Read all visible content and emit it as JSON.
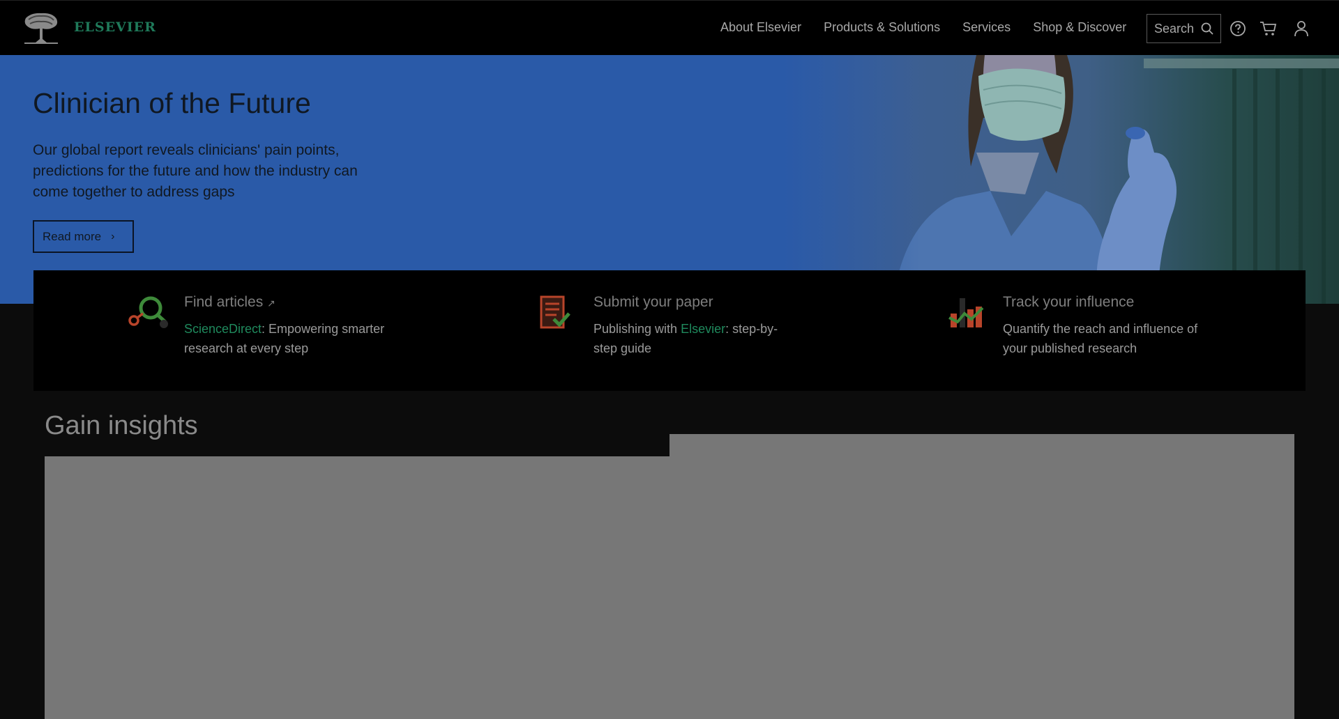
{
  "header": {
    "brand": "ELSEVIER",
    "nav": [
      {
        "label": "About Elsevier"
      },
      {
        "label": "Products & Solutions"
      },
      {
        "label": "Services"
      },
      {
        "label": "Shop & Discover"
      }
    ],
    "search_label": "Search",
    "icons": [
      "help-icon",
      "cart-icon",
      "user-icon"
    ]
  },
  "hero": {
    "title": "Clinician of the Future",
    "description": "Our global report reveals clinicians' pain points, predictions for the future and how the industry can come together to address gaps",
    "button_label": "Read more"
  },
  "quick_links": [
    {
      "title": "Find articles",
      "title_suffix": "↗",
      "accent": "ScienceDirect",
      "desc": ": Empowering smarter research at every step",
      "icon": "magnifier-icon"
    },
    {
      "title": "Submit your paper",
      "desc_prefix": "Publishing with ",
      "accent": "Elsevier",
      "desc": ": step-by-step guide",
      "icon": "document-check-icon"
    },
    {
      "title": "Track your influence",
      "desc": "Quantify the reach and influence of your published research",
      "icon": "bar-chart-icon"
    }
  ],
  "insights": {
    "title": "Gain insights"
  },
  "colors": {
    "accent_green": "#1f8a5d",
    "hero_blue": "#2a5aa8",
    "panel_gray": "#777777"
  }
}
